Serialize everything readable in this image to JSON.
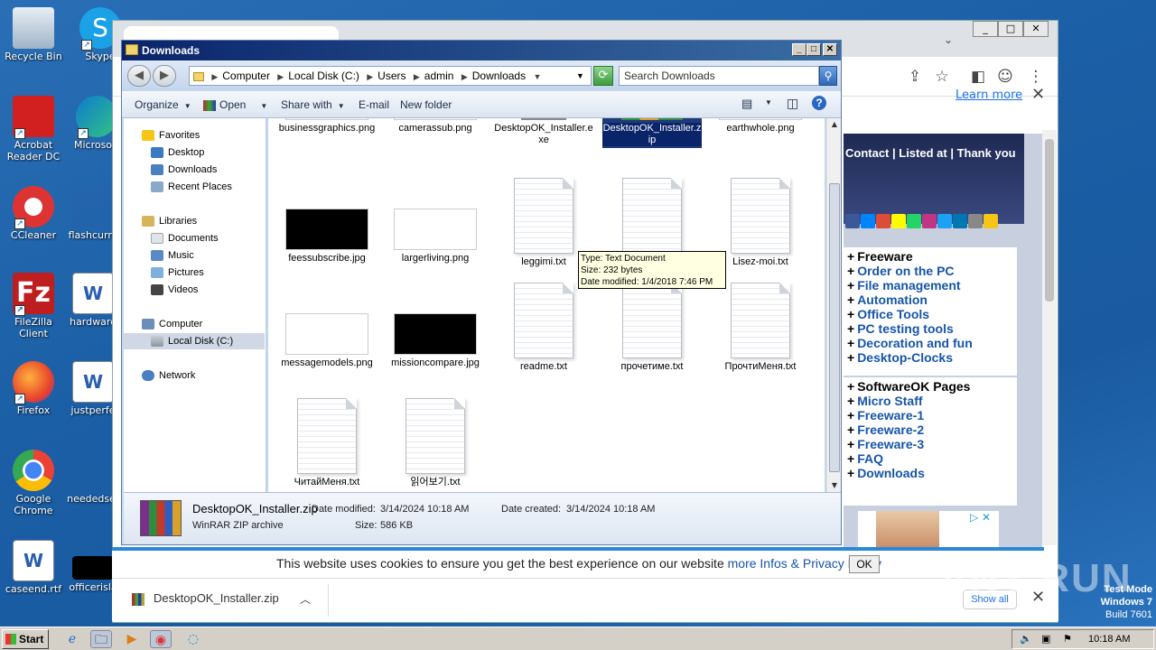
{
  "desktop": {
    "icons": [
      {
        "label": "Recycle Bin",
        "icon": "recycle-bin-icon"
      },
      {
        "label": "Skype",
        "icon": "skype-icon"
      },
      {
        "label": "Acrobat Reader DC",
        "icon": "acrobat-icon"
      },
      {
        "label": "Microsoft",
        "icon": "edge-icon"
      },
      {
        "label": "CCleaner",
        "icon": "ccleaner-icon"
      },
      {
        "label": "flashcurre",
        "icon": "word-doc-icon"
      },
      {
        "label": "FileZilla Client",
        "icon": "filezilla-icon"
      },
      {
        "label": "hardware",
        "icon": "word-doc-icon"
      },
      {
        "label": "Firefox",
        "icon": "firefox-icon"
      },
      {
        "label": "justperfe",
        "icon": "word-doc-icon"
      },
      {
        "label": "Google Chrome",
        "icon": "chrome-icon"
      },
      {
        "label": "neededse",
        "icon": "file-icon"
      },
      {
        "label": "caseend.rtf",
        "icon": "word-doc-icon"
      },
      {
        "label": "officerisla",
        "icon": "image-icon"
      }
    ]
  },
  "browser": {
    "infobar_link": "Learn more",
    "site": {
      "nav_links": "Contact | Listed at | Thank you",
      "freeware_header": "Freeware",
      "freeware_items": [
        "Order on the PC",
        "File management",
        "Automation",
        "Office Tools",
        "PC testing tools",
        "Decoration and fun",
        "Desktop-Clocks"
      ],
      "pages_header": "SoftwareOK Pages",
      "pages_items": [
        "Micro Staff",
        "Freeware-1",
        "Freeware-2",
        "Freeware-3",
        "FAQ",
        "Downloads"
      ]
    },
    "cookie": {
      "text": "This website uses cookies to ensure you get the best experience on our website ",
      "link": "more Infos & Privacy Policy",
      "ok": "OK"
    },
    "download_shelf": {
      "file": "DesktopOK_Installer.zip",
      "show_all": "Show all"
    }
  },
  "explorer": {
    "title": "Downloads",
    "breadcrumb": [
      "Computer",
      "Local Disk (C:)",
      "Users",
      "admin",
      "Downloads"
    ],
    "search_placeholder": "Search Downloads",
    "toolbar": {
      "organize": "Organize",
      "open": "Open",
      "share_with": "Share with",
      "email": "E-mail",
      "new_folder": "New folder"
    },
    "nav": {
      "favorites": "Favorites",
      "desktop": "Desktop",
      "downloads": "Downloads",
      "recent": "Recent Places",
      "libraries": "Libraries",
      "documents": "Documents",
      "music": "Music",
      "pictures": "Pictures",
      "videos": "Videos",
      "computer": "Computer",
      "local_disk": "Local Disk (C:)",
      "network": "Network"
    },
    "files": [
      {
        "name": "businessgraphics.png",
        "kind": "image"
      },
      {
        "name": "camerassub.png",
        "kind": "image"
      },
      {
        "name": "DesktopOK_Installer.exe",
        "kind": "exe"
      },
      {
        "name": "DesktopOK_Installer.zip",
        "kind": "zip"
      },
      {
        "name": "earthwhole.png",
        "kind": "image"
      },
      {
        "name": "feessubscribe.jpg",
        "kind": "image-dark"
      },
      {
        "name": "largerliving.png",
        "kind": "image"
      },
      {
        "name": "leggimi.txt",
        "kind": "txt"
      },
      {
        "name": "",
        "kind": "txt"
      },
      {
        "name": "Lisez-moi.txt",
        "kind": "txt"
      },
      {
        "name": "messagemodels.png",
        "kind": "image"
      },
      {
        "name": "missioncompare.jpg",
        "kind": "image-dark"
      },
      {
        "name": "readme.txt",
        "kind": "txt"
      },
      {
        "name": "прочетиме.txt",
        "kind": "txt"
      },
      {
        "name": "ПрочтиМеня.txt",
        "kind": "txt"
      },
      {
        "name": "ЧитайМеня.txt",
        "kind": "txt"
      },
      {
        "name": "읽어보기.txt",
        "kind": "txt"
      }
    ],
    "tooltip": {
      "type": "Type: Text Document",
      "size": "Size: 232 bytes",
      "modified": "Date modified: 1/4/2018 7:46 PM"
    },
    "details": {
      "name": "DesktopOK_Installer.zip",
      "type": "WinRAR ZIP archive",
      "modified_label": "Date modified:",
      "modified": "3/14/2024 10:18 AM",
      "created_label": "Date created:",
      "created": "3/14/2024 10:18 AM",
      "size_label": "Size:",
      "size": "586 KB"
    }
  },
  "taskbar": {
    "start": "Start",
    "clock": "10:18 AM"
  },
  "watermark": {
    "line1": "Test Mode",
    "line2": "Windows 7",
    "line3": "Build 7601",
    "brand": "ANY RUN"
  }
}
